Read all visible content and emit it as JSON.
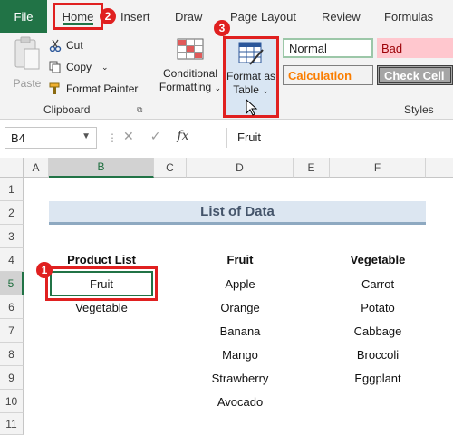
{
  "ribbon_tabs": {
    "file": "File",
    "home": "Home",
    "insert": "Insert",
    "draw": "Draw",
    "page_layout": "Page Layout",
    "review": "Review",
    "formulas": "Formulas"
  },
  "clipboard": {
    "paste": "Paste",
    "cut": "Cut",
    "copy": "Copy",
    "format_painter": "Format Painter",
    "group_label": "Clipboard"
  },
  "styles": {
    "conditional_formatting_line1": "Conditional",
    "conditional_formatting_line2": "Formatting",
    "format_as_table_line1": "Format as",
    "format_as_table_line2": "Table",
    "normal": "Normal",
    "bad": "Bad",
    "calculation": "Calculation",
    "check_cell": "Check Cell",
    "group_label": "Styles"
  },
  "formula_bar": {
    "name_box": "B4",
    "fx": "fx",
    "value": "Fruit"
  },
  "columns": [
    "A",
    "B",
    "C",
    "D",
    "E",
    "F"
  ],
  "rows": [
    "1",
    "2",
    "3",
    "4",
    "5",
    "6",
    "7",
    "8",
    "9",
    "10",
    "11"
  ],
  "sheet": {
    "title": "List of Data",
    "product_list_header": "Product List",
    "product_list": [
      "Fruit",
      "Vegetable"
    ],
    "fruit_header": "Fruit",
    "fruits": [
      "Apple",
      "Orange",
      "Banana",
      "Mango",
      "Strawberry",
      "Avocado"
    ],
    "vegetable_header": "Vegetable",
    "vegetables": [
      "Carrot",
      "Potato",
      "Cabbage",
      "Broccoli",
      "Eggplant"
    ]
  },
  "badges": [
    "1",
    "2",
    "3"
  ],
  "colors": {
    "excel_green": "#217346",
    "highlight_red": "#e02020",
    "title_fill": "#dce6f1"
  }
}
